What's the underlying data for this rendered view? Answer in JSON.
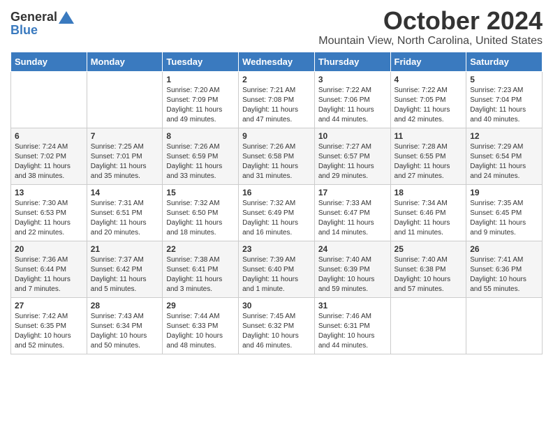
{
  "header": {
    "logo_general": "General",
    "logo_blue": "Blue",
    "month_title": "October 2024",
    "location": "Mountain View, North Carolina, United States"
  },
  "days_of_week": [
    "Sunday",
    "Monday",
    "Tuesday",
    "Wednesday",
    "Thursday",
    "Friday",
    "Saturday"
  ],
  "weeks": [
    [
      {
        "day": "",
        "empty": true
      },
      {
        "day": "",
        "empty": true
      },
      {
        "day": "1",
        "sunrise": "Sunrise: 7:20 AM",
        "sunset": "Sunset: 7:09 PM",
        "daylight": "Daylight: 11 hours and 49 minutes."
      },
      {
        "day": "2",
        "sunrise": "Sunrise: 7:21 AM",
        "sunset": "Sunset: 7:08 PM",
        "daylight": "Daylight: 11 hours and 47 minutes."
      },
      {
        "day": "3",
        "sunrise": "Sunrise: 7:22 AM",
        "sunset": "Sunset: 7:06 PM",
        "daylight": "Daylight: 11 hours and 44 minutes."
      },
      {
        "day": "4",
        "sunrise": "Sunrise: 7:22 AM",
        "sunset": "Sunset: 7:05 PM",
        "daylight": "Daylight: 11 hours and 42 minutes."
      },
      {
        "day": "5",
        "sunrise": "Sunrise: 7:23 AM",
        "sunset": "Sunset: 7:04 PM",
        "daylight": "Daylight: 11 hours and 40 minutes."
      }
    ],
    [
      {
        "day": "6",
        "sunrise": "Sunrise: 7:24 AM",
        "sunset": "Sunset: 7:02 PM",
        "daylight": "Daylight: 11 hours and 38 minutes."
      },
      {
        "day": "7",
        "sunrise": "Sunrise: 7:25 AM",
        "sunset": "Sunset: 7:01 PM",
        "daylight": "Daylight: 11 hours and 35 minutes."
      },
      {
        "day": "8",
        "sunrise": "Sunrise: 7:26 AM",
        "sunset": "Sunset: 6:59 PM",
        "daylight": "Daylight: 11 hours and 33 minutes."
      },
      {
        "day": "9",
        "sunrise": "Sunrise: 7:26 AM",
        "sunset": "Sunset: 6:58 PM",
        "daylight": "Daylight: 11 hours and 31 minutes."
      },
      {
        "day": "10",
        "sunrise": "Sunrise: 7:27 AM",
        "sunset": "Sunset: 6:57 PM",
        "daylight": "Daylight: 11 hours and 29 minutes."
      },
      {
        "day": "11",
        "sunrise": "Sunrise: 7:28 AM",
        "sunset": "Sunset: 6:55 PM",
        "daylight": "Daylight: 11 hours and 27 minutes."
      },
      {
        "day": "12",
        "sunrise": "Sunrise: 7:29 AM",
        "sunset": "Sunset: 6:54 PM",
        "daylight": "Daylight: 11 hours and 24 minutes."
      }
    ],
    [
      {
        "day": "13",
        "sunrise": "Sunrise: 7:30 AM",
        "sunset": "Sunset: 6:53 PM",
        "daylight": "Daylight: 11 hours and 22 minutes."
      },
      {
        "day": "14",
        "sunrise": "Sunrise: 7:31 AM",
        "sunset": "Sunset: 6:51 PM",
        "daylight": "Daylight: 11 hours and 20 minutes."
      },
      {
        "day": "15",
        "sunrise": "Sunrise: 7:32 AM",
        "sunset": "Sunset: 6:50 PM",
        "daylight": "Daylight: 11 hours and 18 minutes."
      },
      {
        "day": "16",
        "sunrise": "Sunrise: 7:32 AM",
        "sunset": "Sunset: 6:49 PM",
        "daylight": "Daylight: 11 hours and 16 minutes."
      },
      {
        "day": "17",
        "sunrise": "Sunrise: 7:33 AM",
        "sunset": "Sunset: 6:47 PM",
        "daylight": "Daylight: 11 hours and 14 minutes."
      },
      {
        "day": "18",
        "sunrise": "Sunrise: 7:34 AM",
        "sunset": "Sunset: 6:46 PM",
        "daylight": "Daylight: 11 hours and 11 minutes."
      },
      {
        "day": "19",
        "sunrise": "Sunrise: 7:35 AM",
        "sunset": "Sunset: 6:45 PM",
        "daylight": "Daylight: 11 hours and 9 minutes."
      }
    ],
    [
      {
        "day": "20",
        "sunrise": "Sunrise: 7:36 AM",
        "sunset": "Sunset: 6:44 PM",
        "daylight": "Daylight: 11 hours and 7 minutes."
      },
      {
        "day": "21",
        "sunrise": "Sunrise: 7:37 AM",
        "sunset": "Sunset: 6:42 PM",
        "daylight": "Daylight: 11 hours and 5 minutes."
      },
      {
        "day": "22",
        "sunrise": "Sunrise: 7:38 AM",
        "sunset": "Sunset: 6:41 PM",
        "daylight": "Daylight: 11 hours and 3 minutes."
      },
      {
        "day": "23",
        "sunrise": "Sunrise: 7:39 AM",
        "sunset": "Sunset: 6:40 PM",
        "daylight": "Daylight: 11 hours and 1 minute."
      },
      {
        "day": "24",
        "sunrise": "Sunrise: 7:40 AM",
        "sunset": "Sunset: 6:39 PM",
        "daylight": "Daylight: 10 hours and 59 minutes."
      },
      {
        "day": "25",
        "sunrise": "Sunrise: 7:40 AM",
        "sunset": "Sunset: 6:38 PM",
        "daylight": "Daylight: 10 hours and 57 minutes."
      },
      {
        "day": "26",
        "sunrise": "Sunrise: 7:41 AM",
        "sunset": "Sunset: 6:36 PM",
        "daylight": "Daylight: 10 hours and 55 minutes."
      }
    ],
    [
      {
        "day": "27",
        "sunrise": "Sunrise: 7:42 AM",
        "sunset": "Sunset: 6:35 PM",
        "daylight": "Daylight: 10 hours and 52 minutes."
      },
      {
        "day": "28",
        "sunrise": "Sunrise: 7:43 AM",
        "sunset": "Sunset: 6:34 PM",
        "daylight": "Daylight: 10 hours and 50 minutes."
      },
      {
        "day": "29",
        "sunrise": "Sunrise: 7:44 AM",
        "sunset": "Sunset: 6:33 PM",
        "daylight": "Daylight: 10 hours and 48 minutes."
      },
      {
        "day": "30",
        "sunrise": "Sunrise: 7:45 AM",
        "sunset": "Sunset: 6:32 PM",
        "daylight": "Daylight: 10 hours and 46 minutes."
      },
      {
        "day": "31",
        "sunrise": "Sunrise: 7:46 AM",
        "sunset": "Sunset: 6:31 PM",
        "daylight": "Daylight: 10 hours and 44 minutes."
      },
      {
        "day": "",
        "empty": true
      },
      {
        "day": "",
        "empty": true
      }
    ]
  ]
}
